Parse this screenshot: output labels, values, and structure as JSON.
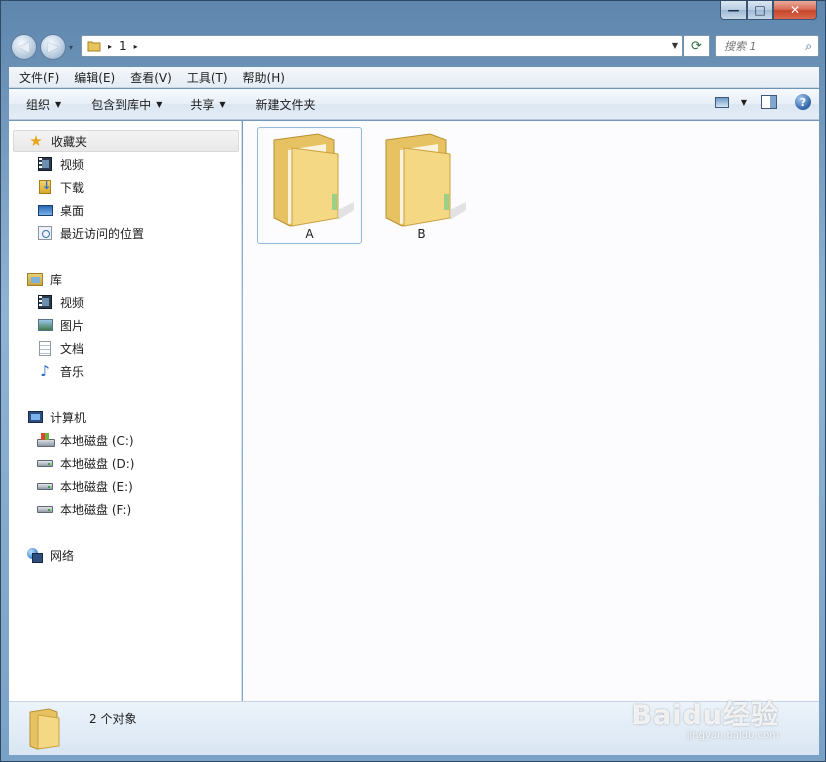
{
  "window": {
    "minimize_glyph": "—",
    "maximize_glyph": "□",
    "close_glyph": "✕"
  },
  "nav": {
    "back_glyph": "◀",
    "forward_glyph": "▶",
    "history_glyph": "▾",
    "breadcrumbs": [
      "1"
    ],
    "crumb_separator": "▸",
    "refresh_glyph": "⟳",
    "search_placeholder": "搜索 1",
    "search_glyph": "⌕"
  },
  "menubar": {
    "items": [
      "文件(F)",
      "编辑(E)",
      "查看(V)",
      "工具(T)",
      "帮助(H)"
    ]
  },
  "commandbar": {
    "organize": "组织",
    "include_in_library": "包含到库中",
    "share": "共享",
    "new_folder": "新建文件夹",
    "help_glyph": "?"
  },
  "sidebar": {
    "favorites": {
      "label": "收藏夹",
      "items": [
        "视频",
        "下载",
        "桌面",
        "最近访问的位置"
      ]
    },
    "libraries": {
      "label": "库",
      "items": [
        "视频",
        "图片",
        "文档",
        "音乐"
      ]
    },
    "computer": {
      "label": "计算机",
      "items": [
        "本地磁盘 (C:)",
        "本地磁盘 (D:)",
        "本地磁盘 (E:)",
        "本地磁盘 (F:)"
      ]
    },
    "network": {
      "label": "网络"
    }
  },
  "content": {
    "files": [
      {
        "name": "A",
        "selected": true
      },
      {
        "name": "B",
        "selected": false
      }
    ]
  },
  "status": {
    "text": "2 个对象"
  },
  "watermark": {
    "main": "Baidu经验",
    "sub": "jingyan.baidu.com"
  },
  "colors": {
    "folder_front": "#f5dc8e",
    "folder_back": "#e7c565",
    "selection_border": "#95b9d8"
  }
}
